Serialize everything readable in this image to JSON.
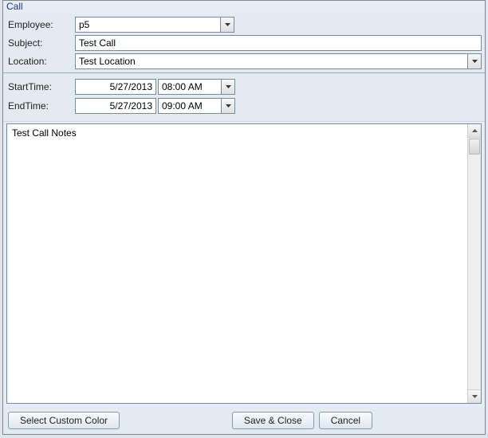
{
  "title": "Call",
  "labels": {
    "employee": "Employee:",
    "subject": "Subject:",
    "location": "Location:",
    "startTime": "StartTime:",
    "endTime": "EndTime:"
  },
  "fields": {
    "employee": "p5",
    "subject": "Test Call",
    "location": "Test Location",
    "startDate": "5/27/2013",
    "startTime": "08:00 AM",
    "endDate": "5/27/2013",
    "endTime": "09:00 AM",
    "notes": "Test Call Notes"
  },
  "buttons": {
    "selectColor": "Select Custom Color",
    "saveClose": "Save & Close",
    "cancel": "Cancel"
  }
}
